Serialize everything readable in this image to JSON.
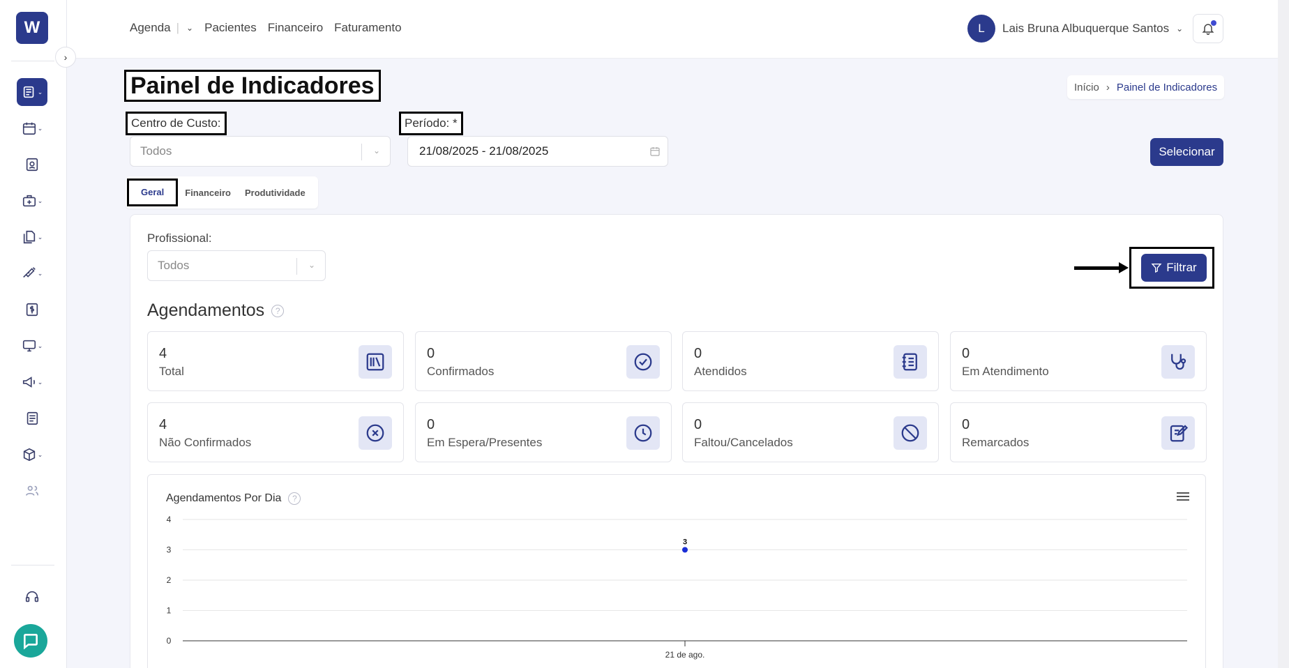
{
  "logo": {
    "letter": "W"
  },
  "topnav": {
    "items": [
      "Agenda",
      "Pacientes",
      "Financeiro",
      "Faturamento"
    ]
  },
  "user": {
    "initial": "L",
    "name": "Lais Bruna Albuquerque Santos"
  },
  "page": {
    "title": "Painel de Indicadores"
  },
  "breadcrumb": {
    "home": "Início",
    "current": "Painel de Indicadores"
  },
  "filters": {
    "centro_label": "Centro de Custo:",
    "centro_value": "Todos",
    "periodo_label": "Período: *",
    "periodo_value": "21/08/2025 - 21/08/2025",
    "select_button": "Selecionar"
  },
  "tabs": [
    "Geral",
    "Financeiro",
    "Produtividade"
  ],
  "profissional": {
    "label": "Profissional:",
    "value": "Todos"
  },
  "filter_button": "Filtrar",
  "agendamentos": {
    "title": "Agendamentos",
    "cards": [
      {
        "value": "4",
        "label": "Total",
        "icon": "books-icon"
      },
      {
        "value": "0",
        "label": "Confirmados",
        "icon": "check-circle-icon"
      },
      {
        "value": "0",
        "label": "Atendidos",
        "icon": "notebook-icon"
      },
      {
        "value": "0",
        "label": "Em Atendimento",
        "icon": "stethoscope-icon"
      },
      {
        "value": "4",
        "label": "Não Confirmados",
        "icon": "x-circle-icon"
      },
      {
        "value": "0",
        "label": "Em Espera/Presentes",
        "icon": "clock-icon"
      },
      {
        "value": "0",
        "label": "Faltou/Cancelados",
        "icon": "ban-icon"
      },
      {
        "value": "0",
        "label": "Remarcados",
        "icon": "edit-note-icon"
      }
    ]
  },
  "chart_data": {
    "type": "line",
    "title": "Agendamentos Por Dia",
    "x": [
      "21 de ago."
    ],
    "series": [
      {
        "values": [
          3
        ],
        "color": "#1a2ed6"
      }
    ],
    "data_labels": [
      "3"
    ],
    "yticks": [
      "0",
      "1",
      "2",
      "3",
      "4"
    ],
    "ylim": [
      0,
      4
    ],
    "grid": true
  }
}
